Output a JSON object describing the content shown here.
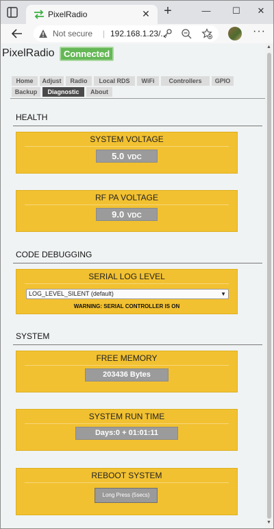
{
  "browser": {
    "tab_title": "PixelRadio",
    "new_tab": "+",
    "win_minimize": "—",
    "win_maximize": "☐",
    "win_close": "✕",
    "not_secure": "Not secure",
    "url": "192.168.1.23/...",
    "menu": "···"
  },
  "app": {
    "brand": "PixelRadio",
    "status": "Connected",
    "status_color": "#65b756",
    "accent": "#f2c131"
  },
  "tabs": [
    "Home",
    "Adjust",
    "Radio",
    "Local RDS",
    "WiFi",
    "Controllers",
    "GPIO",
    "Backup",
    "Diagnostic",
    "About"
  ],
  "active_tab": "Diagnostic",
  "sections": {
    "health": "HEALTH",
    "code_debugging": "CODE DEBUGGING",
    "system": "SYSTEM"
  },
  "cards": {
    "system_voltage": {
      "title": "SYSTEM VOLTAGE",
      "value": "5.0",
      "unit": "VDC"
    },
    "rf_pa_voltage": {
      "title": "RF PA VOLTAGE",
      "value": "9.0",
      "unit": "VDC"
    },
    "serial_log_level": {
      "title": "SERIAL LOG LEVEL",
      "selected": "LOG_LEVEL_SILENT (default)",
      "warning": "WARNING: SERIAL CONTROLLER IS ON"
    },
    "free_memory": {
      "title": "FREE MEMORY",
      "value": "203436 Bytes"
    },
    "run_time": {
      "title": "SYSTEM RUN TIME",
      "value": "Days:0 + 01:01:11"
    },
    "reboot": {
      "title": "REBOOT SYSTEM",
      "button": "Long Press (5secs)"
    }
  }
}
